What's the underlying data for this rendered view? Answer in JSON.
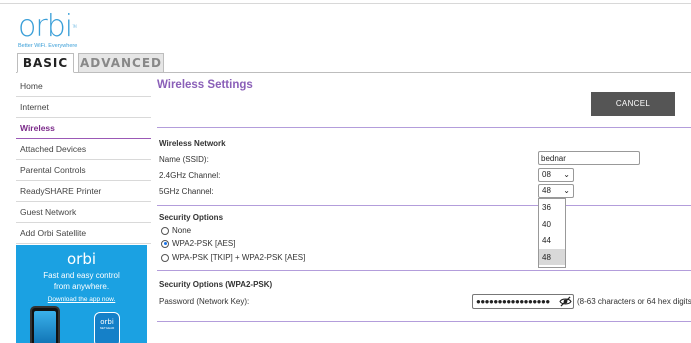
{
  "logo": {
    "word": "orbi",
    "tm": "TM",
    "tagline": "Better WiFi. Everywhere"
  },
  "tabs": [
    {
      "label": "BASIC",
      "active": true
    },
    {
      "label": "ADVANCED",
      "active": false
    }
  ],
  "sidebar": {
    "items": [
      {
        "label": "Home"
      },
      {
        "label": "Internet"
      },
      {
        "label": "Wireless",
        "active": true
      },
      {
        "label": "Attached Devices"
      },
      {
        "label": "Parental Controls"
      },
      {
        "label": "ReadySHARE Printer"
      },
      {
        "label": "Guest Network"
      },
      {
        "label": "Add Orbi Satellite"
      }
    ]
  },
  "promo": {
    "logo": "orbi",
    "line1": "Fast and easy control",
    "line2": "from anywhere.",
    "link": "Download the app now.",
    "device_logo": "orbi",
    "device_sub": "NETGEAR"
  },
  "main": {
    "title": "Wireless Settings",
    "cancel_label": "CANCEL",
    "wireless_network": {
      "heading": "Wireless Network",
      "ssid_label": "Name (SSID):",
      "ssid_value": "bednar",
      "ch24_label": "2.4GHz Channel:",
      "ch24_value": "08",
      "ch5_label": "5GHz Channel:",
      "ch5_value": "48",
      "ch5_options": [
        "36",
        "40",
        "44",
        "48"
      ]
    },
    "security": {
      "heading": "Security Options",
      "options": [
        {
          "label": "None",
          "checked": false
        },
        {
          "label": "WPA2-PSK [AES]",
          "checked": true
        },
        {
          "label": "WPA-PSK [TKIP] + WPA2-PSK [AES]",
          "checked": false
        }
      ]
    },
    "security_wpa2": {
      "heading": "Security Options (WPA2-PSK)",
      "password_label": "Password (Network Key):",
      "password_masked": "●●●●●●●●●●●●●●●●●",
      "password_hint": "(8-63 characters or 64 hex digits"
    }
  },
  "colors": {
    "accent": "#8a5fb8",
    "active_nav": "#7b2a8a",
    "brand_blue": "#3a9fd8",
    "promo_bg": "#1ba1e2",
    "button_bg": "#555555"
  }
}
